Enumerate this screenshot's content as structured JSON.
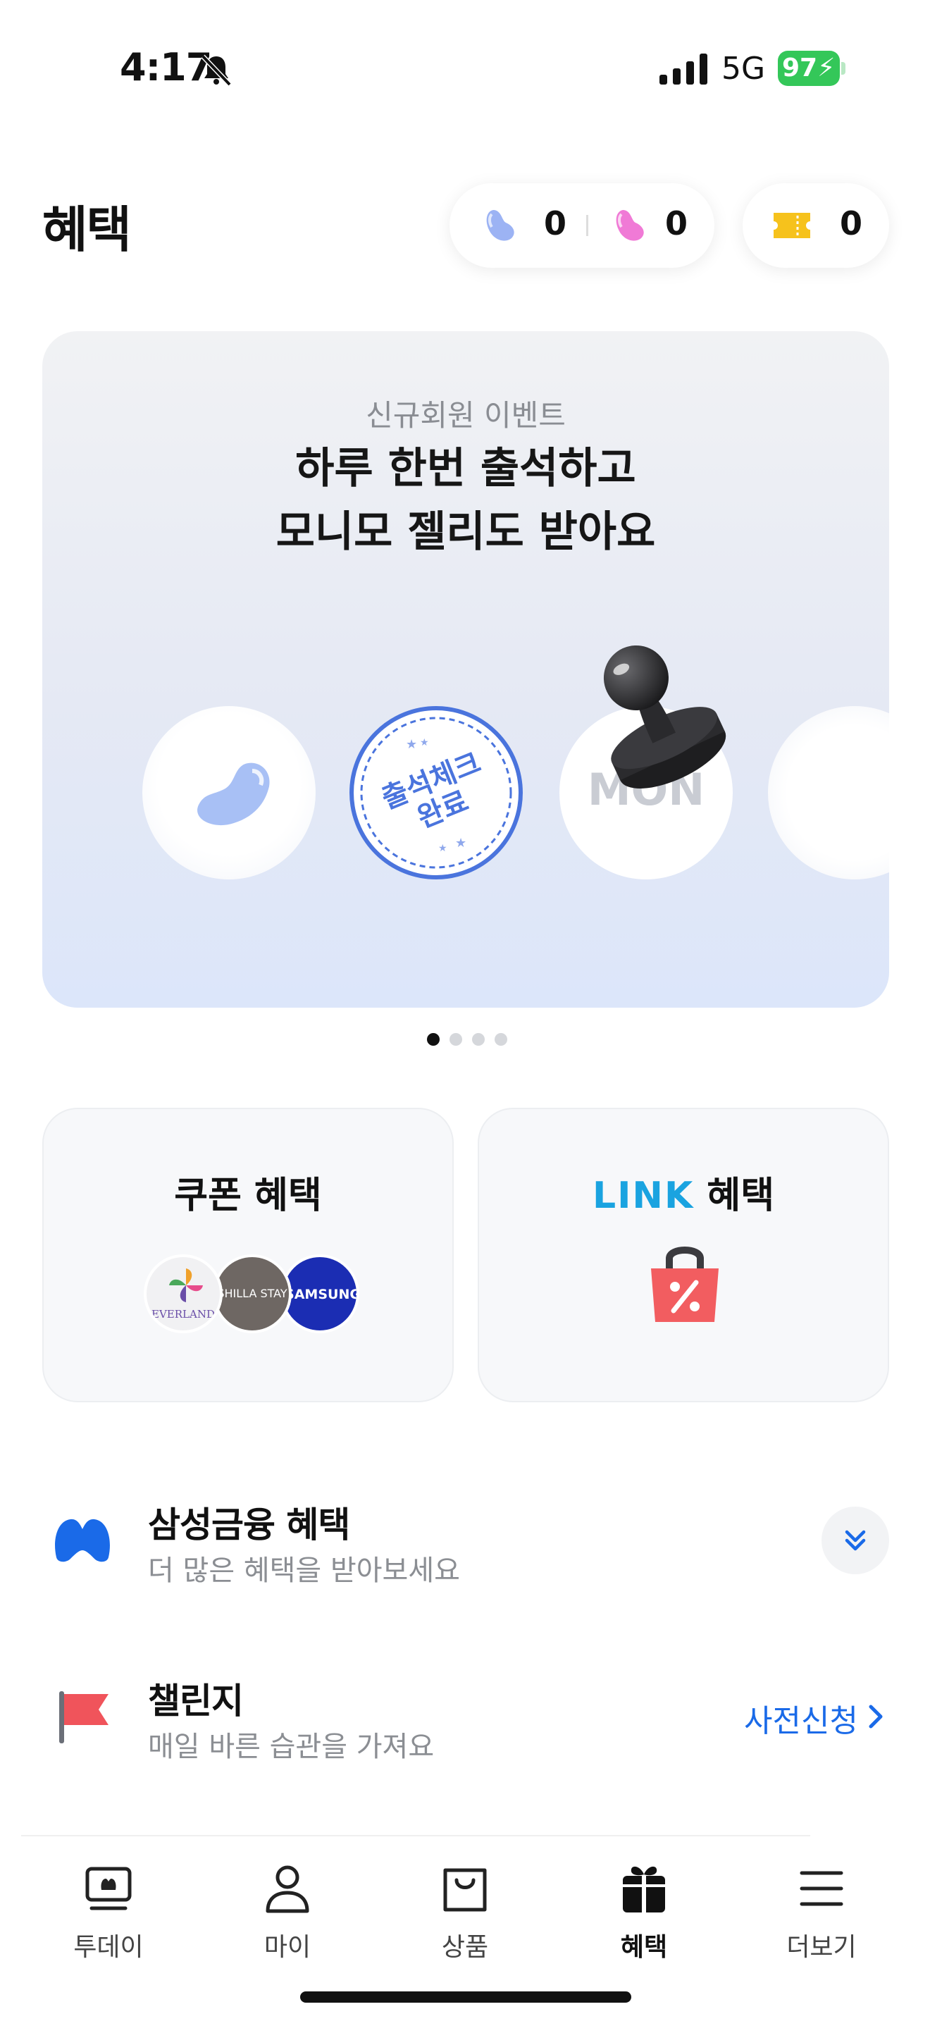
{
  "status_bar": {
    "time": "4:17",
    "network": "5G",
    "battery": "97"
  },
  "header": {
    "title": "혜택",
    "jelly_blue_count": "0",
    "jelly_pink_count": "0",
    "ticket_count": "0"
  },
  "banner": {
    "subtitle": "신규회원 이벤트",
    "title_line1": "하루 한번 출석하고",
    "title_line2": "모니모 젤리도 받아요",
    "stamp_line1": "출석체크",
    "stamp_line2": "완료",
    "day_label": "MON",
    "page_index": 1,
    "page_count": 4
  },
  "cards": {
    "coupon_title": "쿠폰 혜택",
    "coupon_logos": [
      "EVERLAND",
      "SHILLA STAY",
      "SAMSUNG"
    ],
    "link_logo": "LINK",
    "link_suffix": " 혜택"
  },
  "list": {
    "samsung": {
      "title": "삼성금융 혜택",
      "subtitle": "더 많은 혜택을 받아보세요"
    },
    "challenge": {
      "title": "챌린지",
      "subtitle": "매일 바른 습관을 가져요",
      "action": "사전신청"
    }
  },
  "tabbar": {
    "items": [
      {
        "label": "투데이"
      },
      {
        "label": "마이"
      },
      {
        "label": "상품"
      },
      {
        "label": "혜택"
      },
      {
        "label": "더보기"
      }
    ],
    "active": "혜택"
  },
  "colors": {
    "accent_blue": "#1a6ae8",
    "battery_green": "#34c759",
    "flag_red": "#f0545b",
    "link_cyan": "#1aa3e0"
  }
}
